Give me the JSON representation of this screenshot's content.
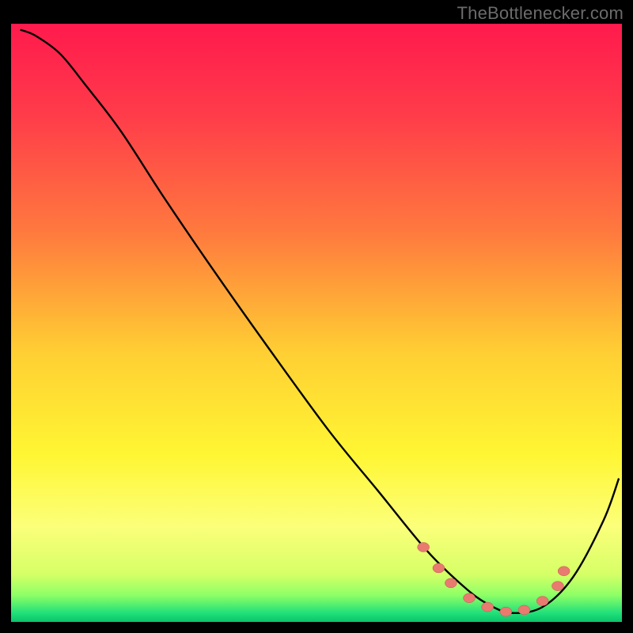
{
  "attribution": "TheBottlenecker.com",
  "colors": {
    "bg": "#000000",
    "attribution_text": "#6b6b6b",
    "gradient_stops": [
      {
        "offset": 0.0,
        "color": "#ff1a4d"
      },
      {
        "offset": 0.15,
        "color": "#ff3b4a"
      },
      {
        "offset": 0.35,
        "color": "#ff7a3e"
      },
      {
        "offset": 0.55,
        "color": "#ffcf33"
      },
      {
        "offset": 0.72,
        "color": "#fff633"
      },
      {
        "offset": 0.84,
        "color": "#fcff7a"
      },
      {
        "offset": 0.92,
        "color": "#d6ff66"
      },
      {
        "offset": 0.955,
        "color": "#8fff66"
      },
      {
        "offset": 0.985,
        "color": "#22e07a"
      },
      {
        "offset": 1.0,
        "color": "#08c46a"
      }
    ],
    "curve_stroke": "#000000",
    "marker_fill": "#e87a70",
    "marker_stroke": "#c05a52"
  },
  "chart_data": {
    "type": "line",
    "title": "",
    "xlabel": "",
    "ylabel": "",
    "xlim": [
      0,
      100
    ],
    "ylim": [
      0,
      100
    ],
    "series": [
      {
        "name": "bottleneck-curve",
        "x": [
          1.5,
          4,
          8,
          12,
          18,
          25,
          33,
          42,
          52,
          60,
          68,
          74,
          78,
          82,
          87,
          92,
          97,
          99.5
        ],
        "y": [
          99,
          98,
          95,
          90,
          82,
          71,
          59,
          46,
          32,
          22,
          12,
          6,
          3,
          1.5,
          2.5,
          7.5,
          17,
          24
        ]
      }
    ],
    "markers": {
      "name": "selected-band",
      "points": [
        {
          "x": 67.5,
          "y": 12.5
        },
        {
          "x": 70.0,
          "y": 9.0
        },
        {
          "x": 72.0,
          "y": 6.5
        },
        {
          "x": 75.0,
          "y": 4.0
        },
        {
          "x": 78.0,
          "y": 2.5
        },
        {
          "x": 81.0,
          "y": 1.7
        },
        {
          "x": 84.0,
          "y": 2.0
        },
        {
          "x": 87.0,
          "y": 3.5
        },
        {
          "x": 89.5,
          "y": 6.0
        },
        {
          "x": 90.5,
          "y": 8.5
        }
      ]
    }
  }
}
